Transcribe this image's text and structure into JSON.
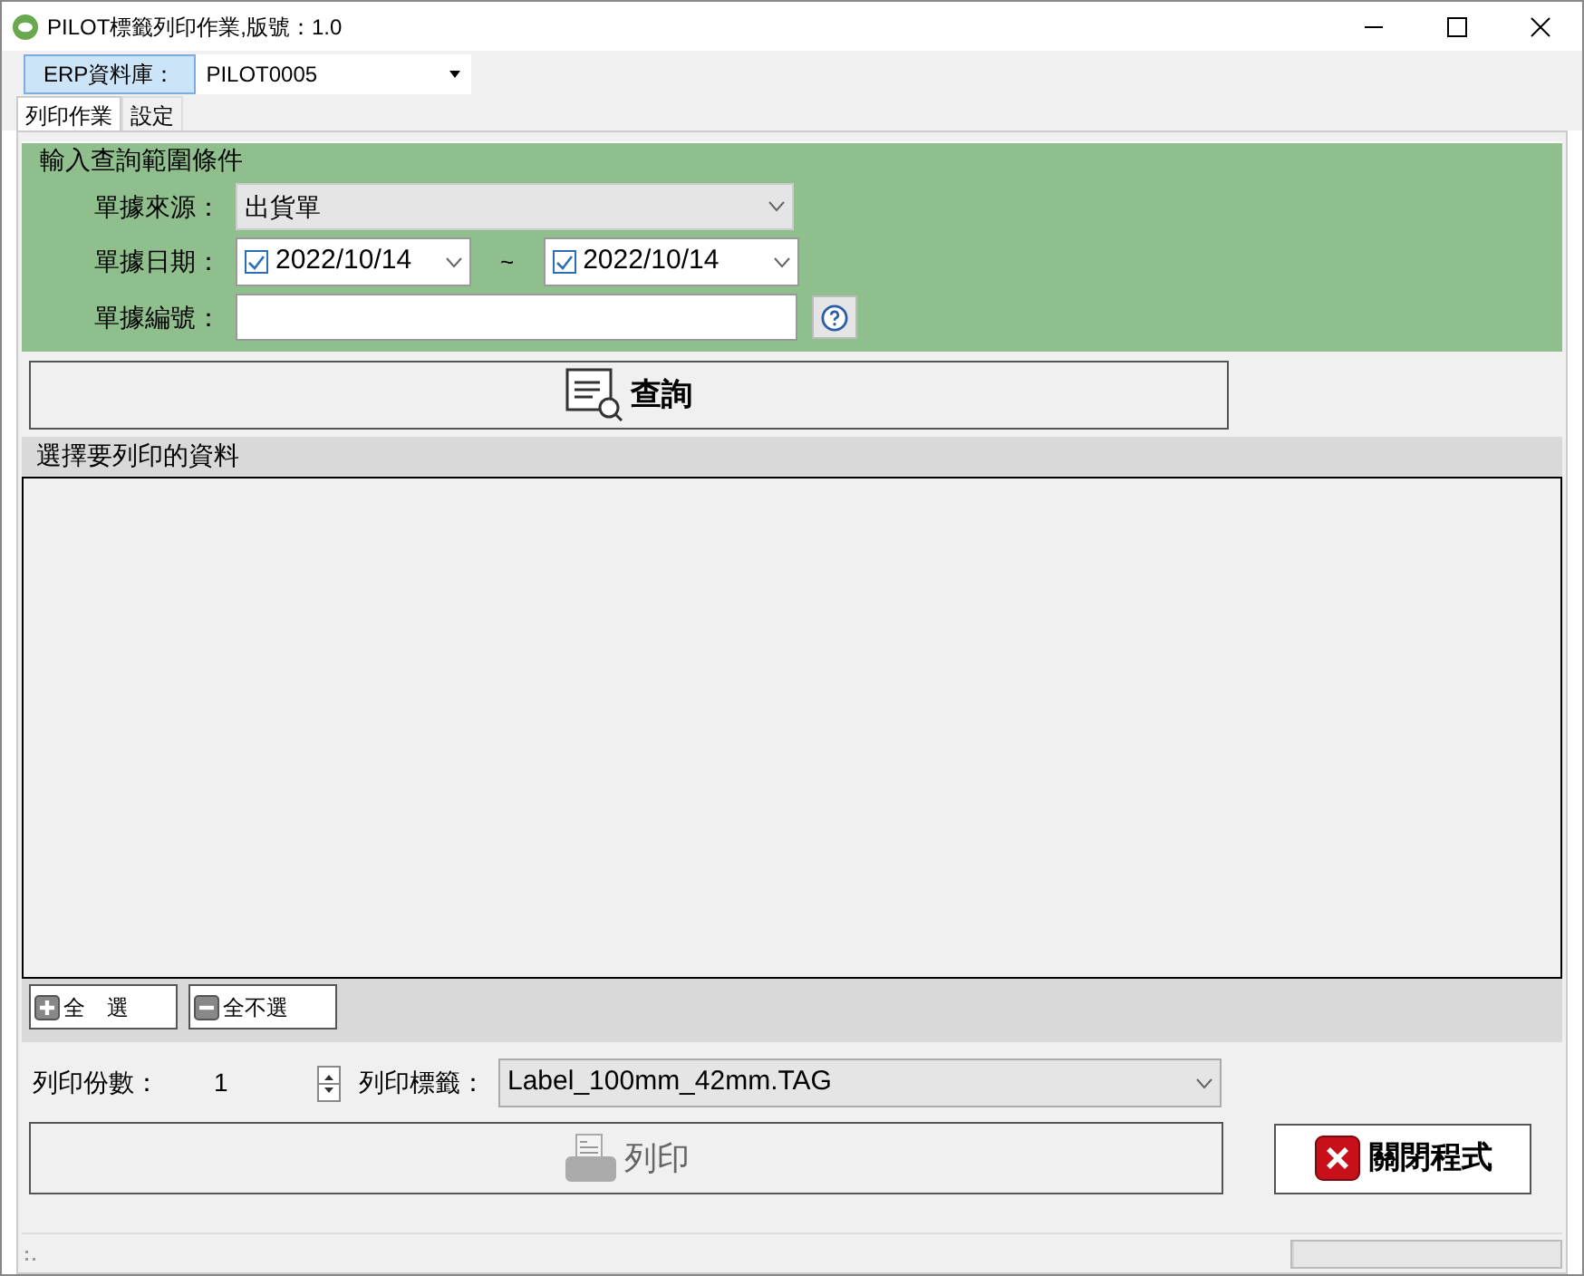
{
  "window": {
    "title": "PILOT標籤列印作業,版號：1.0"
  },
  "toolbar": {
    "label": "ERP資料庫：",
    "value": "PILOT0005"
  },
  "tabs": [
    {
      "label": "列印作業",
      "selected": true
    },
    {
      "label": "設定",
      "selected": false
    }
  ],
  "query_group": {
    "title": "輸入查詢範圍條件",
    "source_label": "單據來源：",
    "source_value": "出貨單",
    "date_label": "單據日期：",
    "date_from": {
      "value": "2022/10/14",
      "checked": true
    },
    "date_separator": "~",
    "date_to": {
      "value": "2022/10/14",
      "checked": true
    },
    "number_label": "單據編號："
  },
  "query_button": {
    "label": "查詢"
  },
  "data_group": {
    "title": "選擇要列印的資料",
    "select_all": "全　選",
    "select_none": "全不選"
  },
  "copies": {
    "label": "列印份數：",
    "value": "1"
  },
  "label_template": {
    "label": "列印標籤：",
    "value": "Label_100mm_42mm.TAG"
  },
  "print_button": {
    "label": "列印",
    "disabled": true
  },
  "close_button": {
    "label": "關閉程式"
  },
  "status_bar": {
    "progress": {
      "level": 0
    }
  }
}
